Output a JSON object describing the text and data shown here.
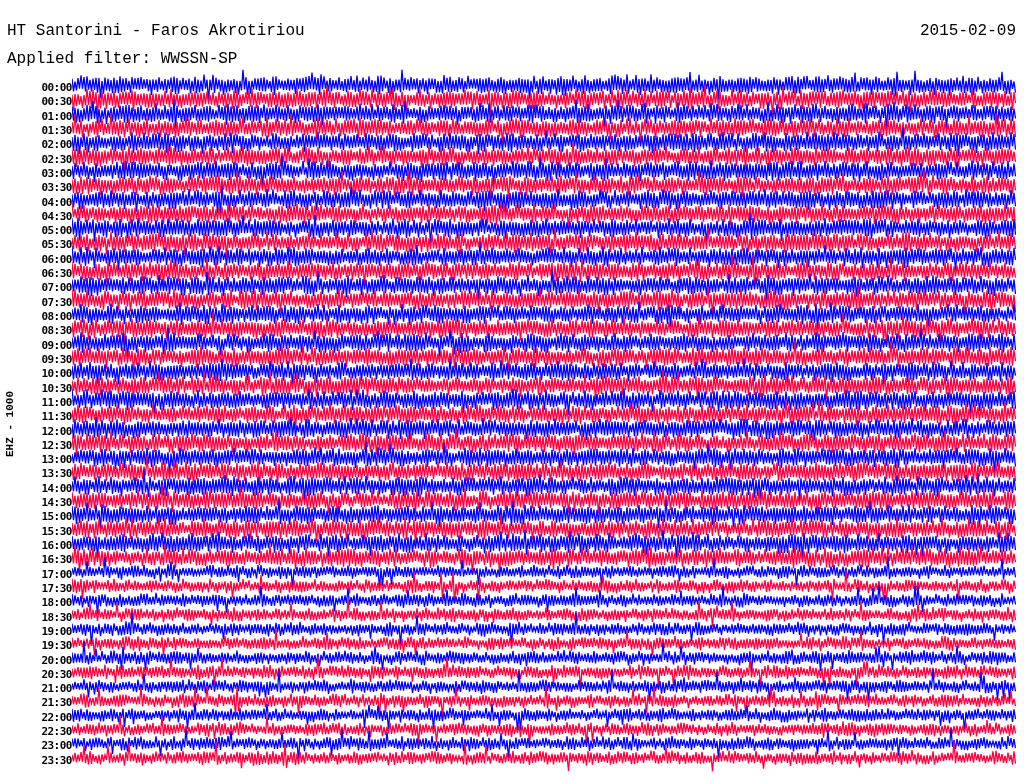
{
  "header": {
    "title": "HT Santorini - Faros Akrotiriou",
    "date": "2015-02-09",
    "filter": "Applied filter: WWSSN-SP"
  },
  "plot": {
    "channel_label": "EHZ - 1000",
    "rows": [
      {
        "time": "00:00",
        "color": "#0000ff"
      },
      {
        "time": "00:30",
        "color": "#ff0040"
      },
      {
        "time": "01:00",
        "color": "#0000ff"
      },
      {
        "time": "01:30",
        "color": "#ff0040"
      },
      {
        "time": "02:00",
        "color": "#0000ff"
      },
      {
        "time": "02:30",
        "color": "#ff0040"
      },
      {
        "time": "03:00",
        "color": "#0000ff"
      },
      {
        "time": "03:30",
        "color": "#ff0040"
      },
      {
        "time": "04:00",
        "color": "#0000ff"
      },
      {
        "time": "04:30",
        "color": "#ff0040"
      },
      {
        "time": "05:00",
        "color": "#0000ff"
      },
      {
        "time": "05:30",
        "color": "#ff0040"
      },
      {
        "time": "06:00",
        "color": "#0000ff"
      },
      {
        "time": "06:30",
        "color": "#ff0040"
      },
      {
        "time": "07:00",
        "color": "#0000ff"
      },
      {
        "time": "07:30",
        "color": "#ff0040"
      },
      {
        "time": "08:00",
        "color": "#0000ff"
      },
      {
        "time": "08:30",
        "color": "#ff0040"
      },
      {
        "time": "09:00",
        "color": "#0000ff"
      },
      {
        "time": "09:30",
        "color": "#ff0040"
      },
      {
        "time": "10:00",
        "color": "#0000ff"
      },
      {
        "time": "10:30",
        "color": "#ff0040"
      },
      {
        "time": "11:00",
        "color": "#0000ff"
      },
      {
        "time": "11:30",
        "color": "#ff0040"
      },
      {
        "time": "12:00",
        "color": "#0000ff"
      },
      {
        "time": "12:30",
        "color": "#ff0040"
      },
      {
        "time": "13:00",
        "color": "#0000ff"
      },
      {
        "time": "13:30",
        "color": "#ff0040"
      },
      {
        "time": "14:00",
        "color": "#0000ff"
      },
      {
        "time": "14:30",
        "color": "#ff0040"
      },
      {
        "time": "15:00",
        "color": "#0000ff"
      },
      {
        "time": "15:30",
        "color": "#ff0040"
      },
      {
        "time": "16:00",
        "color": "#0000ff"
      },
      {
        "time": "16:30",
        "color": "#ff0040"
      },
      {
        "time": "17:00",
        "color": "#0000ff"
      },
      {
        "time": "17:30",
        "color": "#ff0040"
      },
      {
        "time": "18:00",
        "color": "#0000ff"
      },
      {
        "time": "18:30",
        "color": "#ff0040"
      },
      {
        "time": "19:00",
        "color": "#0000ff"
      },
      {
        "time": "19:30",
        "color": "#ff0040"
      },
      {
        "time": "20:00",
        "color": "#0000ff"
      },
      {
        "time": "20:30",
        "color": "#ff0040"
      },
      {
        "time": "21:00",
        "color": "#0000ff"
      },
      {
        "time": "21:30",
        "color": "#ff0040"
      },
      {
        "time": "22:00",
        "color": "#0000ff"
      },
      {
        "time": "22:30",
        "color": "#ff0040"
      },
      {
        "time": "23:00",
        "color": "#0000ff"
      },
      {
        "time": "23:30",
        "color": "#ff0040"
      }
    ]
  }
}
